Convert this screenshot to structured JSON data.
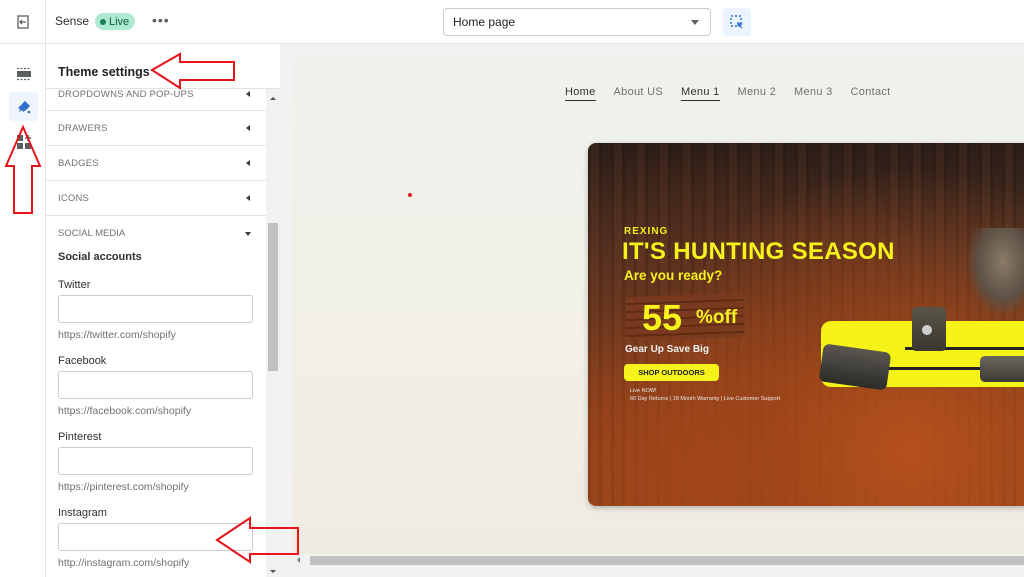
{
  "topbar": {
    "exit_icon": "exit-icon",
    "theme_name": "Sense",
    "status_badge": "Live",
    "more_icon": "more-horizontal-icon",
    "more_label": "•••",
    "page_select": {
      "value": "Home page"
    },
    "inspect_icon": "inspector-icon"
  },
  "rail": {
    "items": [
      {
        "name": "sections",
        "icon": "sections-icon",
        "active": false
      },
      {
        "name": "theme-settings",
        "icon": "paintbrush-icon",
        "active": true
      },
      {
        "name": "app-embeds",
        "icon": "apps-icon",
        "active": false
      }
    ]
  },
  "panel": {
    "title": "Theme settings",
    "sections": [
      {
        "label": "DROPDOWNS AND POP-UPS",
        "expanded": false
      },
      {
        "label": "DRAWERS",
        "expanded": false
      },
      {
        "label": "BADGES",
        "expanded": false
      },
      {
        "label": "ICONS",
        "expanded": false
      },
      {
        "label": "SOCIAL MEDIA",
        "expanded": true
      }
    ],
    "social": {
      "heading": "Social accounts",
      "fields": [
        {
          "label": "Twitter",
          "value": "",
          "help": "https://twitter.com/shopify"
        },
        {
          "label": "Facebook",
          "value": "",
          "help": "https://facebook.com/shopify"
        },
        {
          "label": "Pinterest",
          "value": "",
          "help": "https://pinterest.com/shopify"
        },
        {
          "label": "Instagram",
          "value": "",
          "help": "http://instagram.com/shopify"
        }
      ]
    }
  },
  "preview": {
    "nav": [
      {
        "label": "Home",
        "current": true
      },
      {
        "label": "About US",
        "current": false
      },
      {
        "label": "Menu 1",
        "current": true
      },
      {
        "label": "Menu 2",
        "current": false
      },
      {
        "label": "Menu 3",
        "current": false
      },
      {
        "label": "Contact",
        "current": false
      }
    ],
    "banner": {
      "brand": "REXING",
      "title": "IT'S HUNTING SEASON",
      "subtitle": "Are you ready?",
      "discount_value": "55",
      "discount_suffix": "%off",
      "tagline": "Gear Up Save Big",
      "cta": "SHOP OUTDOORS",
      "fineprint_1": "Live NOW!",
      "fineprint_2": "60 Day Returns | 18 Month Warranty | Live Customer Support"
    }
  },
  "colors": {
    "accent": "#2c6ecb",
    "live_badge_bg": "#aee9d1",
    "live_dot": "#1a7f56",
    "banner_yellow": "#f5f21c",
    "annotation_red": "#e8141b"
  }
}
